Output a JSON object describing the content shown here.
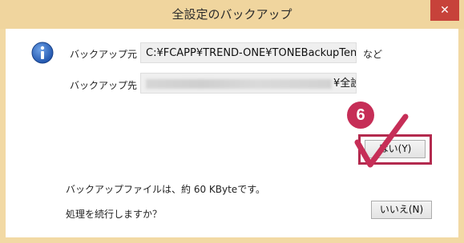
{
  "window": {
    "title": "全設定のバックアップ",
    "close_glyph": "✕"
  },
  "dialog": {
    "source_label": "バックアップ元",
    "source_value": "C:¥FCAPP¥TREND-ONE¥TONEBackupTen",
    "source_suffix": "など",
    "dest_label": "バックアップ先",
    "dest_value_visible": "¥全設",
    "size_message": "バックアップファイルは、約 60 KByteです。",
    "question": "処理を続行しますか？"
  },
  "buttons": {
    "yes_label": "はい(Y)",
    "no_label": "いいえ(N)"
  },
  "annotation": {
    "step_number": "6"
  },
  "colors": {
    "frame": "#f2d9a4",
    "close": "#c7423a",
    "accent": "#c62e57"
  },
  "icons": [
    "info-icon",
    "close-icon",
    "check-mark-icon"
  ]
}
